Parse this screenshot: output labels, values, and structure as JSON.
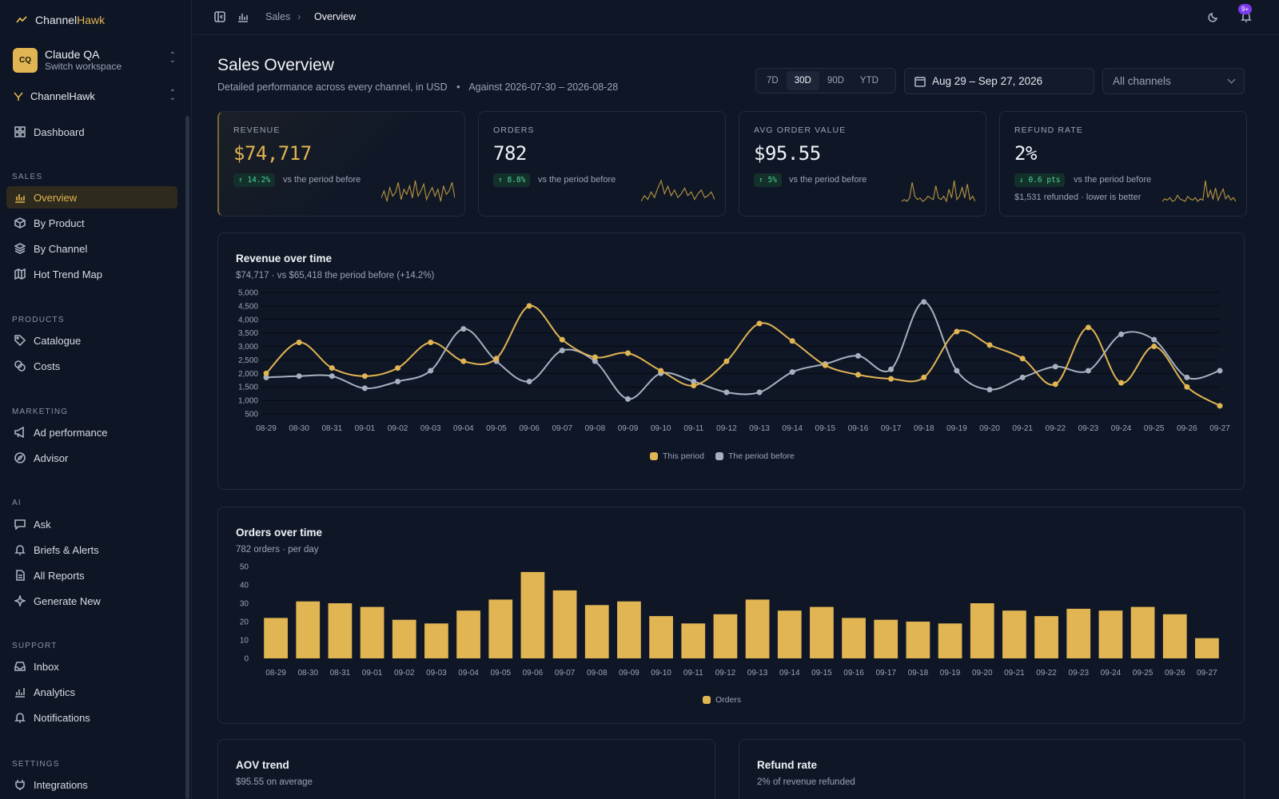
{
  "brand": {
    "name_part1": "Channel",
    "name_part2": "Hawk"
  },
  "workspace": {
    "initials": "CQ",
    "name": "Claude QA",
    "sub": "Switch workspace"
  },
  "project": {
    "name": "ChannelHawk"
  },
  "nav": {
    "dashboard": "Dashboard",
    "sales_label": "SALES",
    "overview": "Overview",
    "by_product": "By Product",
    "by_channel": "By Channel",
    "hot_trend": "Hot Trend Map",
    "products_label": "PRODUCTS",
    "catalogue": "Catalogue",
    "costs": "Costs",
    "marketing_label": "MARKETING",
    "ad_performance": "Ad performance",
    "advisor": "Advisor",
    "ai_label": "AI",
    "ask": "Ask",
    "briefs": "Briefs & Alerts",
    "all_reports": "All Reports",
    "generate_new": "Generate New",
    "support_label": "SUPPORT",
    "inbox": "Inbox",
    "analytics": "Analytics",
    "notifications": "Notifications",
    "settings_label": "SETTINGS",
    "integrations": "Integrations"
  },
  "topbar": {
    "crumb1": "Sales",
    "crumb2": "Overview",
    "notif_badge": "9+"
  },
  "page": {
    "title": "Sales Overview",
    "subtitle": "Detailed performance across every channel, in USD",
    "against": "Against 2026-07-30 – 2026-08-28"
  },
  "ranges": [
    "7D",
    "30D",
    "90D",
    "YTD"
  ],
  "active_range": "30D",
  "date_range": "Aug 29 – Sep 27, 2026",
  "channel_select": "All channels",
  "kpis": {
    "revenue": {
      "label": "REVENUE",
      "value": "$74,717",
      "delta": "↑ 14.2%",
      "cmp": "vs the period before"
    },
    "orders": {
      "label": "ORDERS",
      "value": "782",
      "delta": "↑ 8.8%",
      "cmp": "vs the period before"
    },
    "aov": {
      "label": "AVG ORDER VALUE",
      "value": "$95.55",
      "delta": "↑ 5%",
      "cmp": "vs the period before"
    },
    "refund": {
      "label": "REFUND RATE",
      "value": "2%",
      "delta": "↓ 0.6 pts",
      "cmp": "vs the period before",
      "note": "$1,531 refunded · lower is better"
    }
  },
  "sparklines": {
    "revenue": [
      8,
      12,
      6,
      14,
      9,
      11,
      17,
      7,
      13,
      10,
      15,
      8,
      18,
      9,
      12,
      16,
      7,
      11,
      14,
      9,
      13,
      6,
      15,
      10,
      12,
      17,
      8
    ],
    "orders": [
      5,
      8,
      6,
      10,
      7,
      12,
      16,
      9,
      13,
      8,
      11,
      7,
      9,
      12,
      8,
      10,
      6,
      9,
      11,
      7,
      8,
      10,
      6
    ],
    "aov": [
      3,
      4,
      3,
      5,
      14,
      6,
      4,
      5,
      3,
      4,
      6,
      5,
      4,
      12,
      5,
      4,
      6,
      3,
      10,
      5,
      15,
      4,
      6,
      11,
      5,
      13,
      4,
      6,
      3
    ],
    "refund": [
      3,
      5,
      4,
      6,
      3,
      4,
      8,
      5,
      4,
      3,
      7,
      5,
      4,
      6,
      3,
      5,
      4,
      20,
      6,
      12,
      5,
      14,
      4,
      9,
      13,
      5,
      8,
      4,
      6,
      3
    ]
  },
  "revenue_chart": {
    "title": "Revenue over time",
    "subtitle": "$74,717 · vs $65,418 the period before (+14.2%)",
    "chart_data": {
      "type": "line",
      "x": [
        "08-29",
        "08-30",
        "08-31",
        "09-01",
        "09-02",
        "09-03",
        "09-04",
        "09-05",
        "09-06",
        "09-07",
        "09-08",
        "09-09",
        "09-10",
        "09-11",
        "09-12",
        "09-13",
        "09-14",
        "09-15",
        "09-16",
        "09-17",
        "09-18",
        "09-19",
        "09-20",
        "09-21",
        "09-22",
        "09-23",
        "09-24",
        "09-25",
        "09-26",
        "09-27"
      ],
      "yticks": [
        "5,000",
        "4,500",
        "4,000",
        "3,500",
        "3,000",
        "2,500",
        "2,000",
        "1,500",
        "1,000",
        "500"
      ],
      "ylim": [
        500,
        5000
      ],
      "series": [
        {
          "name": "This period",
          "color": "#e2b553",
          "values": [
            2000,
            3150,
            2200,
            1900,
            2200,
            3150,
            2450,
            2550,
            4500,
            3250,
            2600,
            2750,
            2100,
            1550,
            2450,
            3850,
            3200,
            2300,
            1950,
            1800,
            1850,
            3550,
            3050,
            2550,
            1600,
            3700,
            1650,
            3000,
            1500,
            800
          ]
        },
        {
          "name": "The period before",
          "color": "#a7b0c0",
          "values": [
            1850,
            1900,
            1900,
            1450,
            1700,
            2100,
            3650,
            2450,
            1700,
            2850,
            2450,
            1050,
            2000,
            1700,
            1300,
            1300,
            2050,
            2350,
            2650,
            2150,
            4650,
            2100,
            1400,
            1850,
            2250,
            2100,
            3450,
            3250,
            1850,
            2100
          ]
        }
      ],
      "legend_position": "bottom"
    }
  },
  "orders_chart": {
    "title": "Orders over time",
    "subtitle": "782 orders · per day",
    "chart_data": {
      "type": "bar",
      "categories": [
        "08-29",
        "08-30",
        "08-31",
        "09-01",
        "09-02",
        "09-03",
        "09-04",
        "09-05",
        "09-06",
        "09-07",
        "09-08",
        "09-09",
        "09-10",
        "09-11",
        "09-12",
        "09-13",
        "09-14",
        "09-15",
        "09-16",
        "09-17",
        "09-18",
        "09-19",
        "09-20",
        "09-21",
        "09-22",
        "09-23",
        "09-24",
        "09-25",
        "09-26",
        "09-27"
      ],
      "values": [
        22,
        31,
        30,
        28,
        21,
        19,
        26,
        32,
        47,
        37,
        29,
        31,
        23,
        19,
        24,
        32,
        26,
        28,
        22,
        21,
        20,
        19,
        30,
        26,
        23,
        27,
        26,
        28,
        24,
        11
      ],
      "yticks": [
        "50",
        "40",
        "30",
        "20",
        "10",
        "0"
      ],
      "ylim": [
        0,
        50
      ],
      "series_name": "Orders",
      "color": "#e2b553",
      "legend_position": "bottom"
    }
  },
  "aov_card": {
    "title": "AOV trend",
    "subtitle": "$95.55 on average"
  },
  "refund_card": {
    "title": "Refund rate",
    "subtitle": "2% of revenue refunded"
  }
}
